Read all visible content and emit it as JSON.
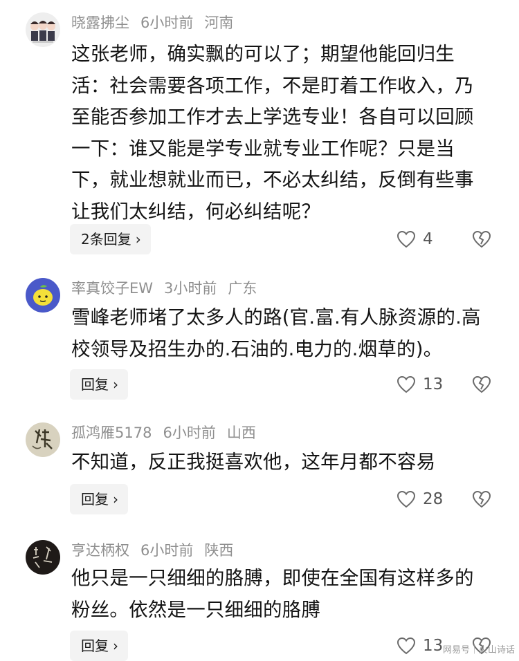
{
  "colors": {
    "username": "#8f8f8f",
    "text": "#141414",
    "reply_bg": "#f3f3f3",
    "icon": "#6a6a6a"
  },
  "comments": [
    {
      "avatar": "three-figures-avatar",
      "username": "晓露拂尘",
      "time": "6小时前",
      "location": "河南",
      "lines": [
        "这张老师，确实飘的可以了；期望他能回归生",
        "活：社会需要各项工作，不是盯着工作收入，乃",
        "至能否参加工作才去上学选专业！各自可以回顾",
        "一下：谁又能是学专业就专业工作呢？只是当",
        "下，就业想就业而已，不必太纠结，反倒有些事",
        "让我们太纠结，何必纠结呢？"
      ],
      "reply_label": "2条回复",
      "likes": "4"
    },
    {
      "avatar": "lemon-avatar",
      "username": "率真饺子EW",
      "time": "3小时前",
      "location": "广东",
      "lines": [
        "雪峰老师堵了太多人的路(官.富.有人脉资源的.高",
        "校领导及招生办的.石油的.电力的.烟草的)。"
      ],
      "reply_label": "回复",
      "likes": "13"
    },
    {
      "avatar": "calligraphy-avatar",
      "username": "孤鸿雁5178",
      "time": "6小时前",
      "location": "山西",
      "lines": [
        "不知道，反正我挺喜欢他，这年月都不容易"
      ],
      "reply_label": "回复",
      "likes": "28"
    },
    {
      "avatar": "dark-calligraphy-avatar",
      "username": "亨达柄权",
      "time": "6小时前",
      "location": "陕西",
      "lines": [
        "他只是一只细细的胳膊，即使在全国有这样多的",
        "粉丝。依然是一只细细的胳膊"
      ],
      "reply_label": "回复",
      "likes": "13"
    }
  ],
  "watermark": "网易号｜火山诗话"
}
